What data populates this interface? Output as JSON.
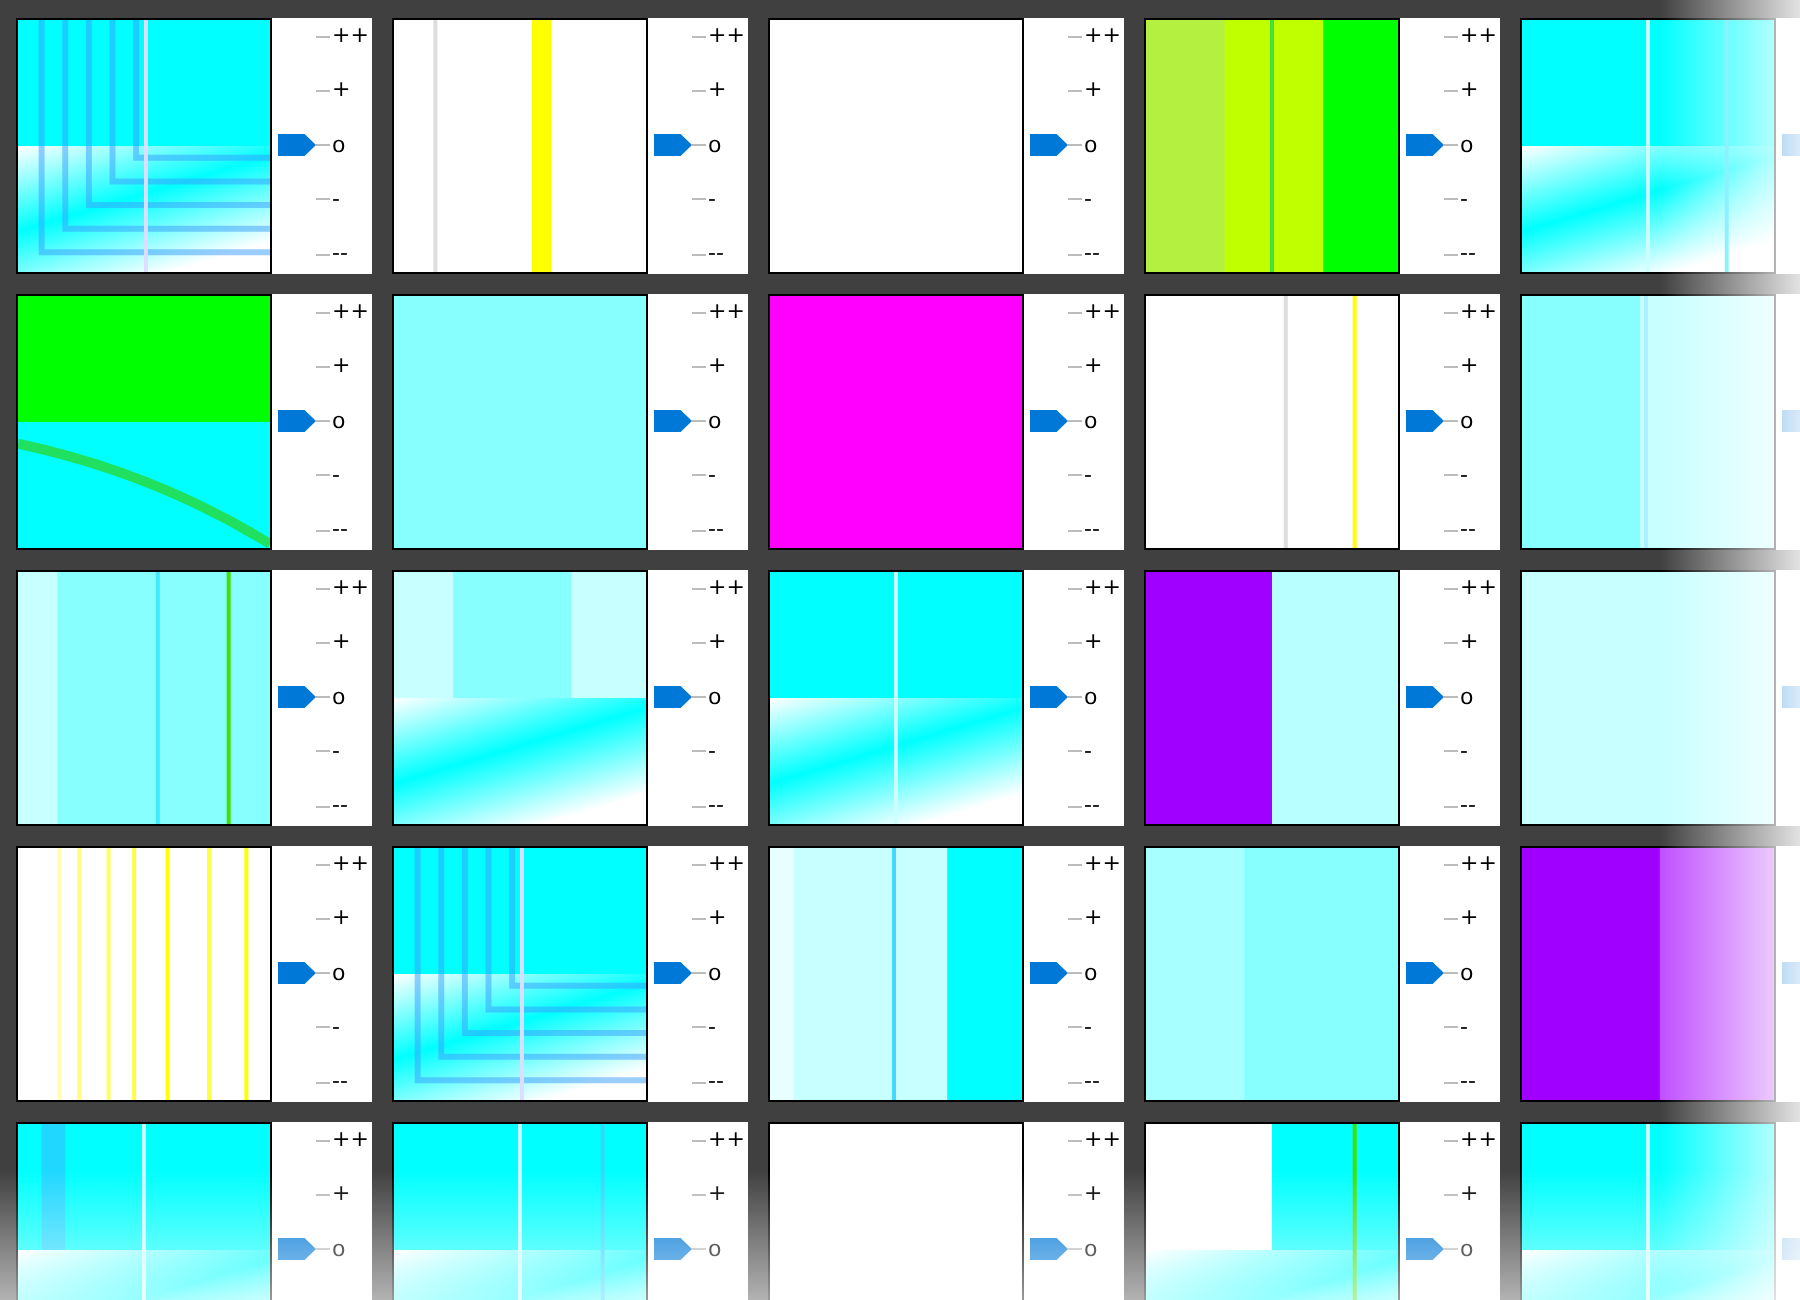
{
  "tiles": [
    {
      "labels": [
        "++",
        "+",
        "o",
        "-",
        "--"
      ],
      "level": 0.5
    },
    {
      "labels": [
        "++",
        "+",
        "o",
        "-",
        "--"
      ],
      "level": 0.5
    },
    {
      "labels": [
        "++",
        "+",
        "o",
        "-",
        "--"
      ],
      "level": 0.5
    },
    {
      "labels": [
        "++",
        "+",
        "o",
        "-",
        "--"
      ],
      "level": 0.5
    },
    {
      "level": 0.5
    },
    {
      "labels": [
        "++",
        "+",
        "o",
        "-",
        "--"
      ],
      "level": 0.5
    },
    {
      "labels": [
        "++",
        "+",
        "o",
        "-",
        "--"
      ],
      "level": 0.5
    },
    {
      "labels": [
        "++",
        "+",
        "o",
        "-",
        "--"
      ],
      "level": 0.5
    },
    {
      "labels": [
        "++",
        "+",
        "o",
        "-",
        "--"
      ],
      "level": 0.5
    },
    {
      "level": 0.5
    },
    {
      "labels": [
        "++",
        "+",
        "o",
        "-",
        "--"
      ],
      "level": 0.5
    },
    {
      "labels": [
        "++",
        "+",
        "o",
        "-",
        "--"
      ],
      "level": 0.5
    },
    {
      "labels": [
        "++",
        "+",
        "o",
        "-",
        "--"
      ],
      "level": 0.5
    },
    {
      "labels": [
        "++",
        "+",
        "o",
        "-",
        "--"
      ],
      "level": 0.5
    },
    {
      "level": 0.5
    },
    {
      "labels": [
        "++",
        "+",
        "o",
        "-",
        "--"
      ],
      "level": 0.5
    },
    {
      "labels": [
        "++",
        "+",
        "o",
        "-",
        "--"
      ],
      "level": 0.5
    },
    {
      "labels": [
        "++",
        "+",
        "o",
        "-",
        "--"
      ],
      "level": 0.5
    },
    {
      "labels": [
        "++",
        "+",
        "o",
        "-",
        "--"
      ],
      "level": 0.5
    },
    {
      "level": 0.5
    },
    {
      "labels": [
        "++",
        "+",
        "o"
      ],
      "level": 0.5
    },
    {
      "labels": [
        "++",
        "+",
        "o"
      ],
      "level": 0.5
    },
    {
      "labels": [
        "++",
        "+",
        "o"
      ],
      "level": 0.5
    },
    {
      "labels": [
        "++",
        "+",
        "o"
      ],
      "level": 0.5
    },
    {
      "level": 0.5
    }
  ]
}
